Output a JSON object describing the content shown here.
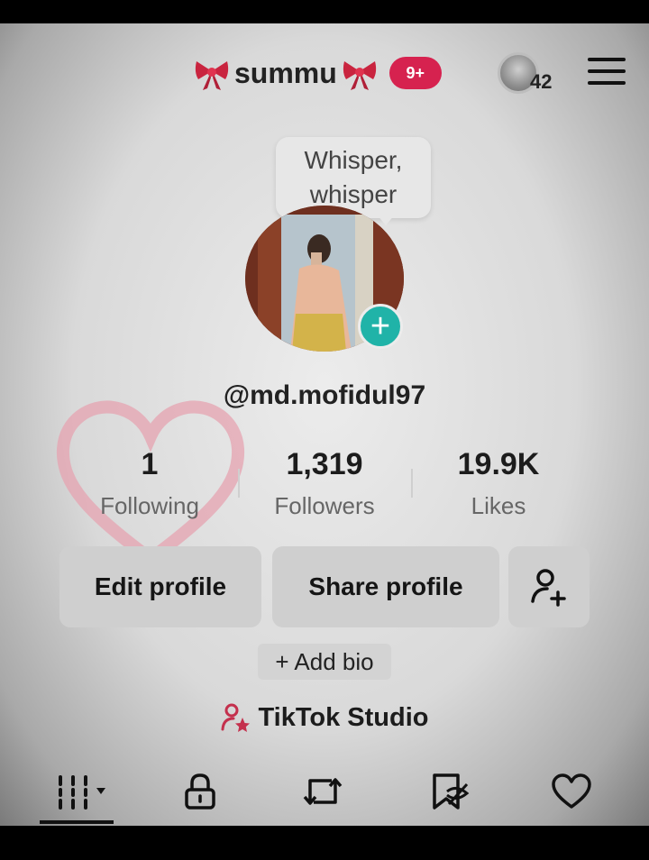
{
  "header": {
    "display_name": "summu",
    "notifications_badge": "9+",
    "account_switch_count": "42",
    "badge_color": "#d6224f"
  },
  "bubble": {
    "line1": "Whisper,",
    "line2": "whisper"
  },
  "profile": {
    "username": "@md.mofidul97",
    "add_button_color": "#20b3a8"
  },
  "stats": [
    {
      "value": "1",
      "label": "Following"
    },
    {
      "value": "1,319",
      "label": "Followers"
    },
    {
      "value": "19.9K",
      "label": "Likes"
    }
  ],
  "buttons": {
    "edit_profile": "Edit profile",
    "share_profile": "Share profile",
    "add_bio": "+ Add bio",
    "tiktok_studio": "TikTok Studio"
  },
  "tabs": [
    {
      "icon": "grid-icon",
      "selected": true
    },
    {
      "icon": "lock-icon"
    },
    {
      "icon": "repost-icon"
    },
    {
      "icon": "saved-icon"
    },
    {
      "icon": "heart-icon"
    }
  ]
}
